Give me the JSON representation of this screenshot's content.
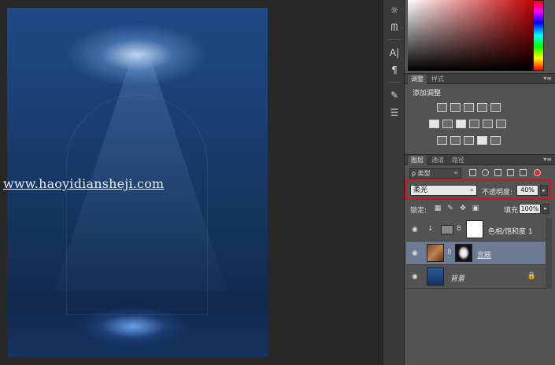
{
  "watermark": "www.haoyidiansheji.com",
  "colors": {
    "highlight": "#d2141e",
    "panel_bg": "#535353",
    "workspace_bg": "#282828",
    "selected_layer": "#6c7a93"
  },
  "toolcol": {
    "icons": [
      "adjust-icon",
      "levels-icon",
      "character-icon",
      "paragraph-icon",
      "brush-icon",
      "preset-icon"
    ],
    "glyphs": [
      "☼",
      "ᗰ",
      "A|",
      "¶",
      "✎",
      "☰"
    ]
  },
  "adjust_panel": {
    "tabs": [
      "调整",
      "样式"
    ],
    "menu_glyph": "▾≡",
    "title": "添加调整"
  },
  "layers_panel": {
    "tabs": [
      "图层",
      "通道",
      "路径"
    ],
    "menu_glyph": "▾≡",
    "filter": {
      "kind_label": "ρ 类型",
      "arrow": "÷"
    },
    "blend_mode": "柔光",
    "blend_arrow": "÷",
    "opacity_label": "不透明度:",
    "opacity_value": "40%",
    "opacity_arrow": "▸",
    "lock_label": "锁定:",
    "fill_label": "填充:",
    "fill_value": "100%",
    "fill_arrow": "▸",
    "layers": [
      {
        "name": "色相/饱和度 1",
        "selected": false
      },
      {
        "name": "宫殿",
        "selected": true
      },
      {
        "name": "背景",
        "selected": false
      }
    ]
  },
  "glyphs": {
    "eye": "◉",
    "chain": "8",
    "link_arrow": "↓",
    "lock": "🔒"
  }
}
